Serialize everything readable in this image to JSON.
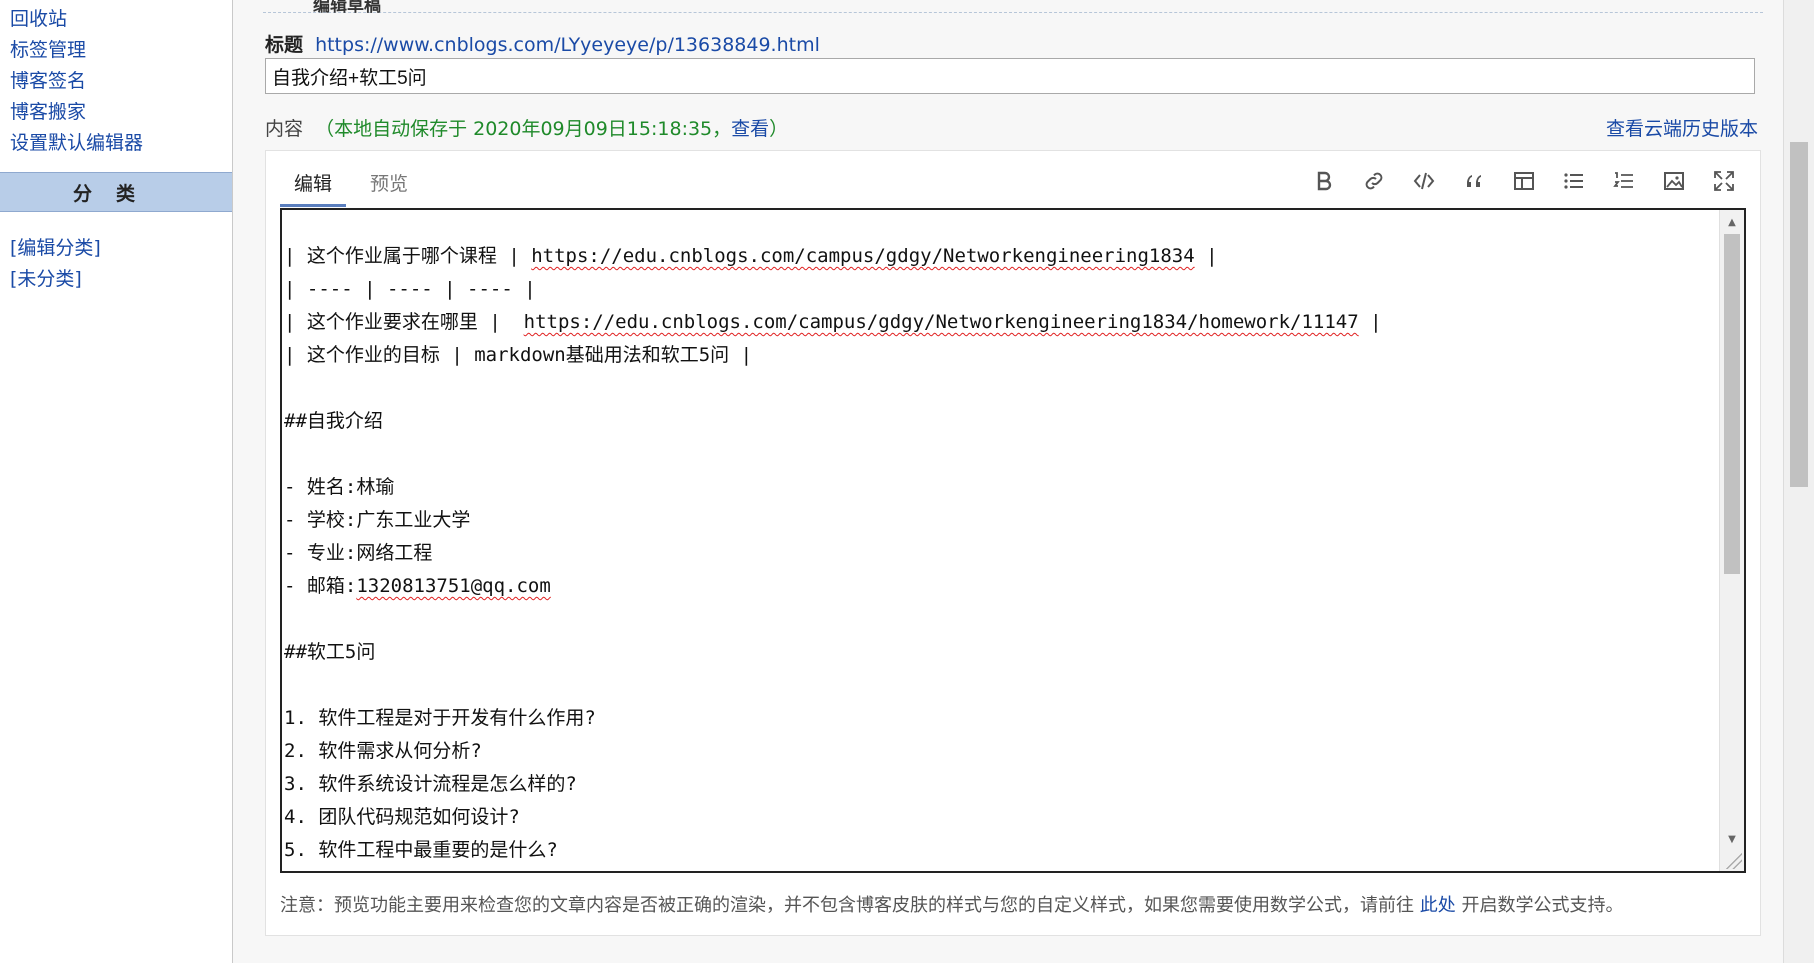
{
  "sidebar": {
    "links": [
      "回收站",
      "标签管理",
      "博客签名",
      "博客搬家",
      "设置默认编辑器"
    ],
    "category_header": "分类",
    "category_links": [
      "[编辑分类]",
      "[未分类]"
    ]
  },
  "editor": {
    "section_heading": "编辑草稿",
    "title_label": "标题",
    "title_url": "https://www.cnblogs.com/LYyeyeye/p/13638849.html",
    "title_value": "自我介绍+软工5问",
    "content_label": "内容",
    "autosave_prefix": "（本地自动保存于 2020年09月09日15:18:35，",
    "autosave_view": "查看",
    "autosave_suffix": "）",
    "history_link": "查看云端历史版本",
    "tabs": [
      "编辑",
      "预览"
    ],
    "toolbar_icons": [
      "bold-icon",
      "link-icon",
      "code-icon",
      "quote-icon",
      "table-icon",
      "bullet-list-icon",
      "numbered-list-icon",
      "image-icon",
      "fullscreen-icon"
    ],
    "lines": [
      "| 这个作业属于哪个课程 | https://edu.cnblogs.com/campus/gdgy/Networkengineering1834 |",
      "| ---- | ---- | ---- |",
      "| 这个作业要求在哪里 |  https://edu.cnblogs.com/campus/gdgy/Networkengineering1834/homework/11147 |",
      "| 这个作业的目标 | markdown基础用法和软工5问 |",
      "",
      "##自我介绍",
      "",
      "- 姓名:林瑜",
      "- 学校:广东工业大学",
      "- 专业:网络工程",
      "- 邮箱:1320813751@qq.com",
      "",
      "##软工5问",
      "",
      "1. 软件工程是对于开发有什么作用?",
      "2. 软件需求从何分析?",
      "3. 软件系统设计流程是怎么样的?",
      "4. 团队代码规范如何设计?",
      "5. 软件工程中最重要的是什么?"
    ],
    "note_prefix": "注意：预览功能主要用来检查您的文章内容是否被正确的渲染，并不包含博客皮肤的样式与您的自定义样式，如果您需要使用数学公式，请前往 ",
    "note_link": "此处",
    "note_suffix": " 开启数学公式支持。"
  }
}
